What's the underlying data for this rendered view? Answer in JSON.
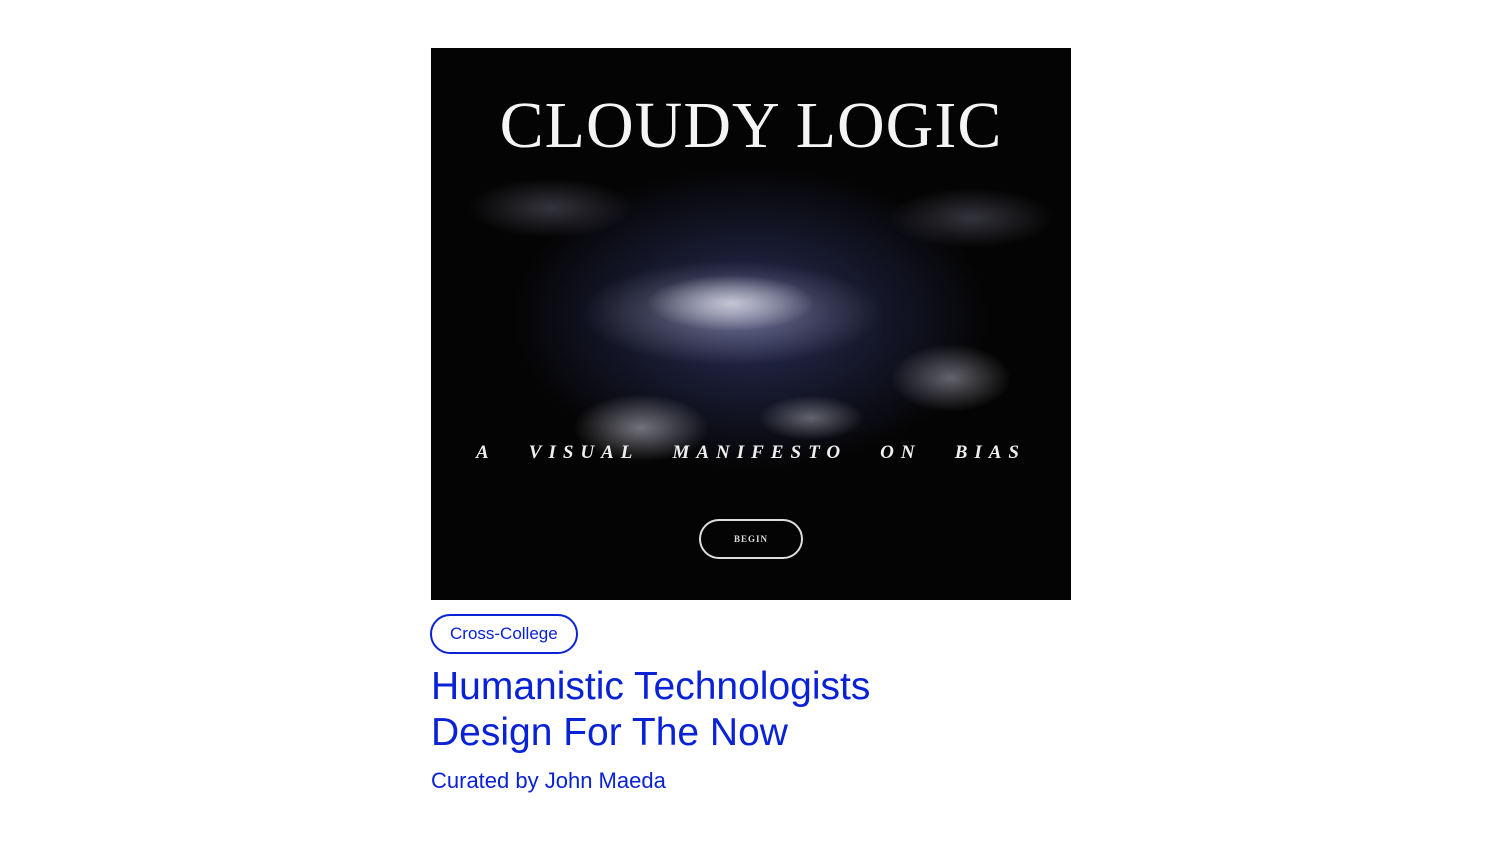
{
  "hero": {
    "title": "CLOUDY LOGIC",
    "subtitle_words": [
      "A",
      "VISUAL",
      "MANIFESTO",
      "ON",
      "BIAS"
    ],
    "begin_label": "BEGIN"
  },
  "card": {
    "tag": "Cross-College",
    "title_line1": "Humanistic Technologists",
    "title_line2": "Design For The Now",
    "curator": "Curated by John Maeda"
  },
  "colors": {
    "accent": "#0a22d6",
    "hero_bg": "#040404"
  }
}
